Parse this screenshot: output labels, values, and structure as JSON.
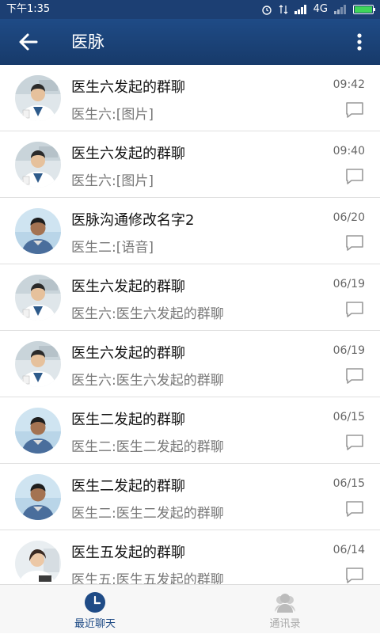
{
  "status_bar": {
    "time": "下午1:35",
    "network": "4G",
    "battery_level": 1.0
  },
  "header": {
    "title": "医脉"
  },
  "chats": [
    {
      "name": "医生六发起的群聊",
      "preview": "医生六:[图片]",
      "time": "09:42",
      "avatar": "doctor-six"
    },
    {
      "name": "医生六发起的群聊",
      "preview": "医生六:[图片]",
      "time": "09:40",
      "avatar": "doctor-six"
    },
    {
      "name": "医脉沟通修改名字2",
      "preview": "医生二:[语音]",
      "time": "06/20",
      "avatar": "doctor-two"
    },
    {
      "name": "医生六发起的群聊",
      "preview": "医生六:医生六发起的群聊",
      "time": "06/19",
      "avatar": "doctor-six"
    },
    {
      "name": "医生六发起的群聊",
      "preview": "医生六:医生六发起的群聊",
      "time": "06/19",
      "avatar": "doctor-six"
    },
    {
      "name": "医生二发起的群聊",
      "preview": "医生二:医生二发起的群聊",
      "time": "06/15",
      "avatar": "doctor-two"
    },
    {
      "name": "医生二发起的群聊",
      "preview": "医生二:医生二发起的群聊",
      "time": "06/15",
      "avatar": "doctor-two"
    },
    {
      "name": "医生五发起的群聊",
      "preview": "医生五:医生五发起的群聊",
      "time": "06/14",
      "avatar": "doctor-five"
    }
  ],
  "bottom_nav": {
    "recent_label": "最近聊天",
    "contacts_label": "通讯录"
  },
  "colors": {
    "header": "#1f4b86",
    "active_tab": "#1f4b86",
    "inactive_tab": "#bbbbbb"
  }
}
